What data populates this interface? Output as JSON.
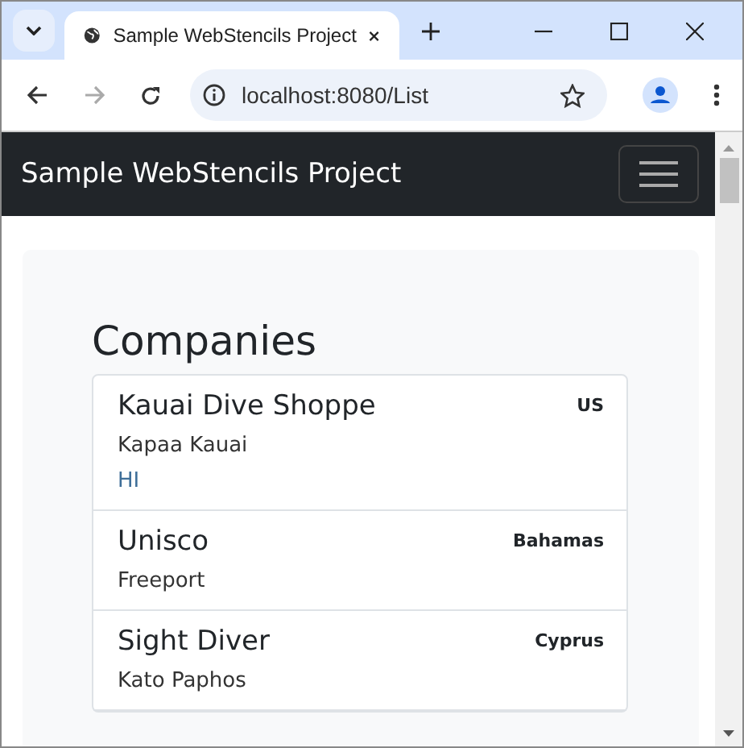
{
  "browser": {
    "tab_title": "Sample WebStencils Project",
    "address": "localhost:8080/List"
  },
  "navbar": {
    "brand": "Sample WebStencils Project"
  },
  "heading": "Companies",
  "companies": [
    {
      "name": "Kauai Dive Shoppe",
      "city": "Kapaa Kauai",
      "state": "HI",
      "country": "US"
    },
    {
      "name": "Unisco",
      "city": "Freeport",
      "country": "Bahamas"
    },
    {
      "name": "Sight Diver",
      "city": "Kato Paphos",
      "country": "Cyprus"
    }
  ]
}
